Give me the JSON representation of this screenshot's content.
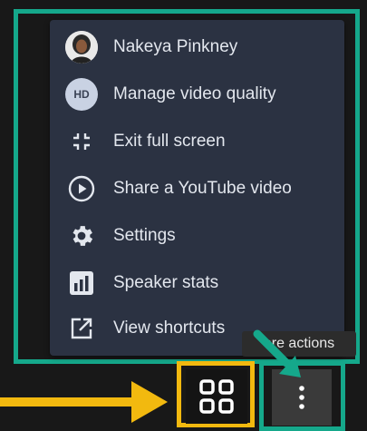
{
  "menu": {
    "items": [
      {
        "label": "Nakeya Pinkney",
        "icon": "user-avatar"
      },
      {
        "label": "Manage video quality",
        "icon": "hd-icon",
        "badge": "HD"
      },
      {
        "label": "Exit full screen",
        "icon": "exit-fullscreen-icon"
      },
      {
        "label": "Share a YouTube video",
        "icon": "play-circle-icon"
      },
      {
        "label": "Settings",
        "icon": "gear-icon"
      },
      {
        "label": "Speaker stats",
        "icon": "bar-chart-icon"
      },
      {
        "label": "View shortcuts",
        "icon": "external-link-icon"
      }
    ]
  },
  "tooltip": {
    "text": "ore actions"
  },
  "colors": {
    "menu_bg": "#2b3242",
    "highlight_teal": "#15a88b",
    "highlight_yellow": "#f2b90f",
    "text": "#e3e7ee"
  }
}
